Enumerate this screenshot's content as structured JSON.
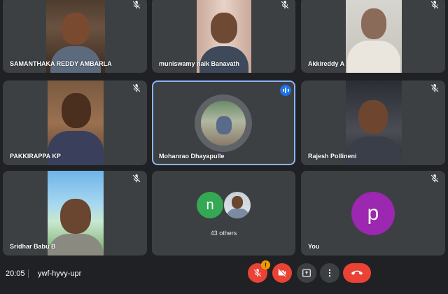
{
  "participants": [
    {
      "name": "SAMANTHAKA REDDY AMBARLA",
      "muted": true
    },
    {
      "name": "muniswamy naik Banavath",
      "muted": true
    },
    {
      "name": "Akkireddy A",
      "muted": true
    },
    {
      "name": "PAKKIRAPPA KP",
      "muted": true
    },
    {
      "name": "Mohanrao Dhayapulle",
      "speaking": true
    },
    {
      "name": "Rajesh Pollineni",
      "muted": true
    },
    {
      "name": "Sridhar Babu B",
      "muted": true
    },
    {
      "name": "",
      "group_initial": "n",
      "others_label": "43 others"
    },
    {
      "name": "You",
      "initial": "p",
      "muted": true
    }
  ],
  "colors": {
    "tile": "#3c4043",
    "active_border": "#8ab4f8",
    "green_avatar": "#34a853",
    "purple_avatar": "#9c27b0",
    "danger": "#ea4335",
    "hand_badge": "#f29900"
  },
  "meeting": {
    "time": "20:05",
    "code": "ywf-hyvy-upr"
  },
  "controls": {
    "mic": "mic-off-icon",
    "camera": "camera-off-icon",
    "present": "present-screen-icon",
    "more": "more-vert-icon",
    "leave": "call-end-icon",
    "badge_icon": "raised-hand-icon"
  }
}
